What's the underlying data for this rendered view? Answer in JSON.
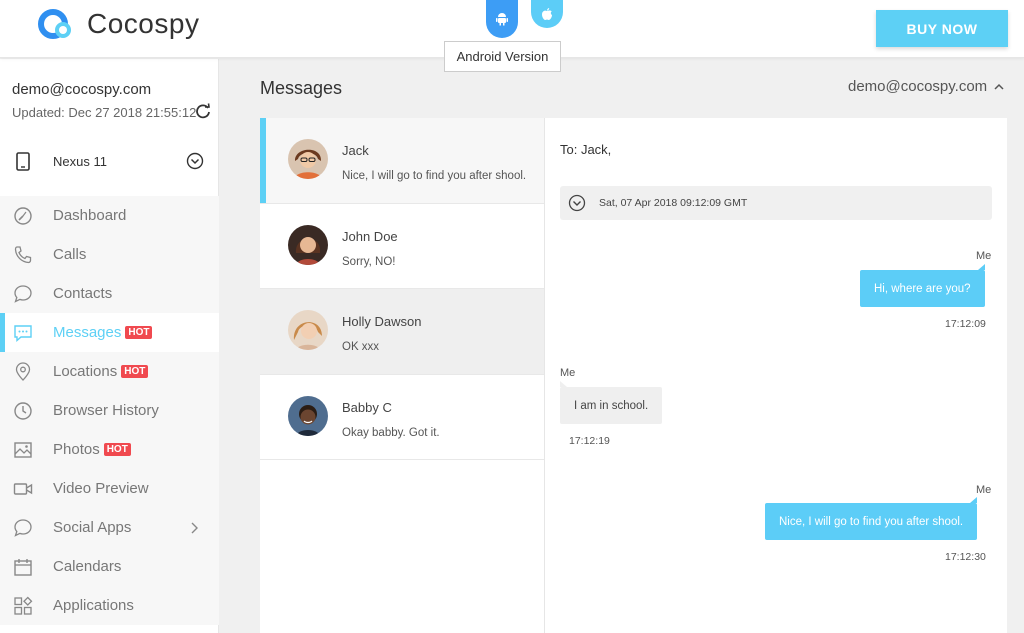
{
  "header": {
    "brand": "Cocospy",
    "tooltip": "Android Version",
    "buy_label": "BUY NOW"
  },
  "sidebar": {
    "email": "demo@cocospy.com",
    "updated": "Updated: Dec 27 2018 21:55:12",
    "device": "Nexus 11",
    "hot_label": "HOT",
    "items": [
      {
        "label": "Dashboard",
        "icon": "dashboard-icon"
      },
      {
        "label": "Calls",
        "icon": "phone-call-icon"
      },
      {
        "label": "Contacts",
        "icon": "chat-bubble-icon"
      },
      {
        "label": "Messages",
        "icon": "message-icon",
        "hot": true,
        "active": true
      },
      {
        "label": "Locations",
        "icon": "map-pin-icon",
        "hot": true
      },
      {
        "label": "Browser History",
        "icon": "clock-icon"
      },
      {
        "label": "Photos",
        "icon": "image-icon",
        "hot": true
      },
      {
        "label": "Video Preview",
        "icon": "video-camera-icon"
      },
      {
        "label": "Social Apps",
        "icon": "speech-icon",
        "submenu": true
      },
      {
        "label": "Calendars",
        "icon": "calendar-icon"
      },
      {
        "label": "Applications",
        "icon": "apps-grid-icon"
      }
    ]
  },
  "main": {
    "title": "Messages",
    "account": "demo@cocospy.com",
    "conversations": [
      {
        "name": "Jack",
        "preview": "Nice, I will go to find you after shool."
      },
      {
        "name": "John Doe",
        "preview": "Sorry, NO!"
      },
      {
        "name": "Holly Dawson",
        "preview": "OK xxx"
      },
      {
        "name": "Babby C",
        "preview": "Okay babby. Got it."
      }
    ],
    "thread": {
      "to": "To: Jack,",
      "date": "Sat, 07 Apr 2018 09:12:09 GMT",
      "messages": [
        {
          "sender": "Me",
          "text": "Hi, where are you?",
          "time": "17:12:09",
          "dir": "out"
        },
        {
          "sender": "Me",
          "text": "I am in school.",
          "time": "17:12:19",
          "dir": "in"
        },
        {
          "sender": "Me",
          "text": "Nice, I will go to find you after shool.",
          "time": "17:12:30",
          "dir": "out"
        }
      ]
    }
  },
  "colors": {
    "accent": "#5dd0f5",
    "android": "#3d9df5",
    "hot": "#f0494f"
  }
}
